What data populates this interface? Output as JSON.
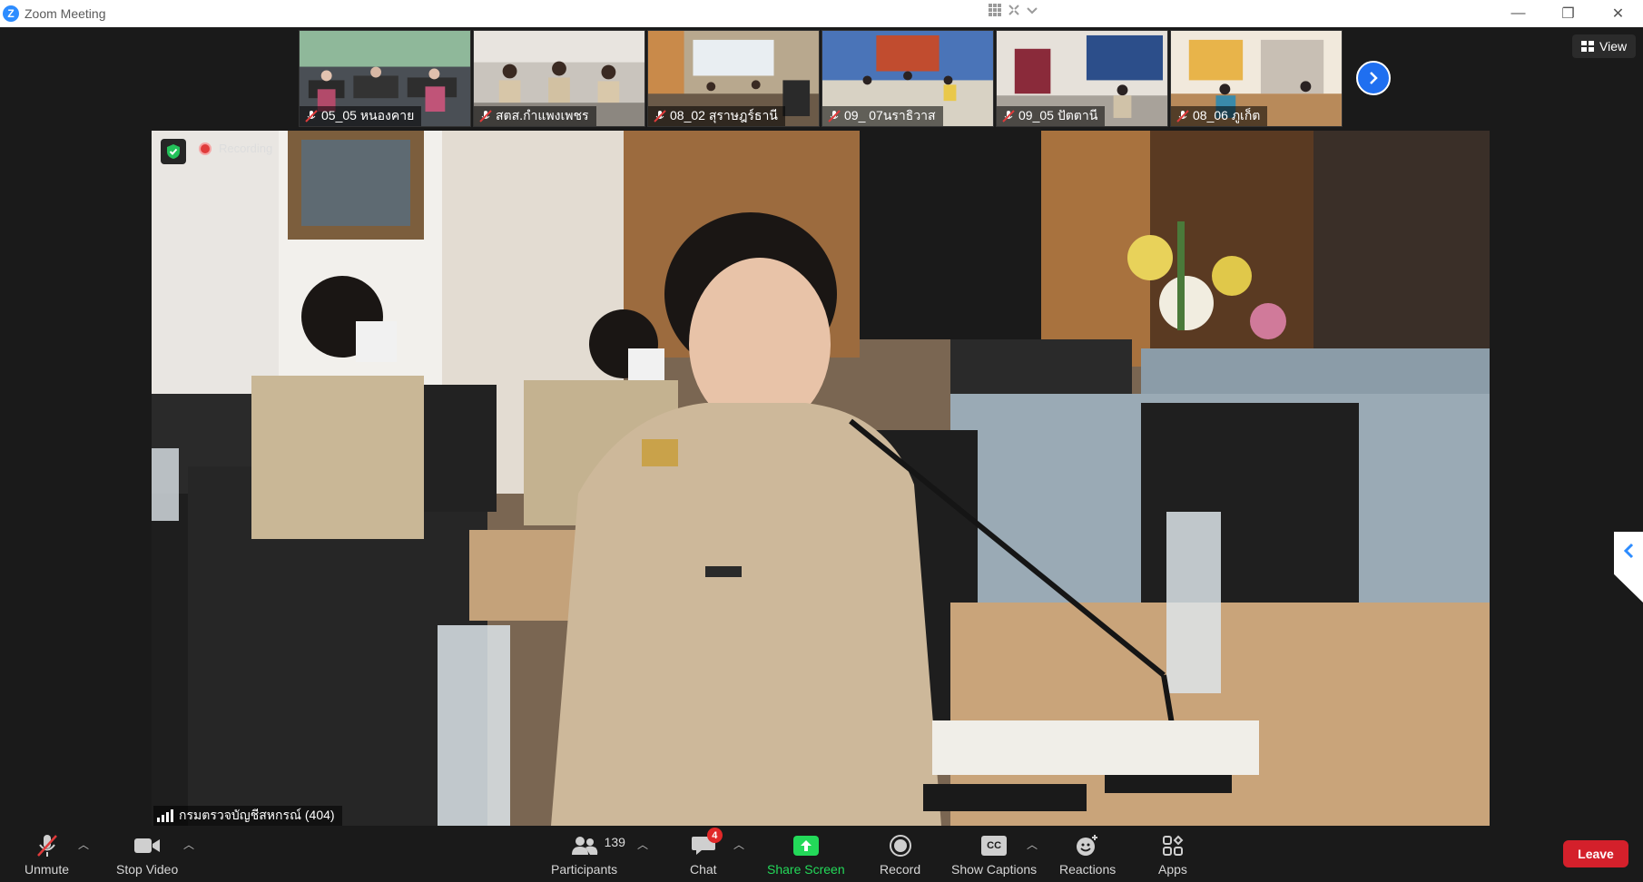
{
  "window": {
    "title": "Zoom Meeting",
    "logo_letter": "Z",
    "minimize": "—",
    "restore": "❐",
    "close": "✕"
  },
  "view_button": {
    "label": "View"
  },
  "thumbnails": [
    {
      "label": "05_05 หนองคาย"
    },
    {
      "label": "สตส.กำแพงเพชร"
    },
    {
      "label": "08_02 สุราษฎร์ธานี"
    },
    {
      "label": "09_ 07นราธิวาส"
    },
    {
      "label": "09_05 ปัตตานี"
    },
    {
      "label": "08_06 ภูเก็ต"
    }
  ],
  "speaker": {
    "name": "กรมตรวจบัญชีสหกรณ์ (404)",
    "recording_label": "Recording"
  },
  "toolbar": {
    "unmute": "Unmute",
    "stop_video": "Stop Video",
    "participants": "Participants",
    "participants_count": "139",
    "chat": "Chat",
    "chat_badge": "4",
    "share_screen": "Share Screen",
    "record": "Record",
    "show_captions": "Show Captions",
    "captions_icon_text": "CC",
    "reactions": "Reactions",
    "apps": "Apps",
    "leave": "Leave"
  },
  "colors": {
    "accent": "#2d8cff",
    "share_green": "#23d959",
    "leave_red": "#d4202b",
    "mic_off_red": "#e03b3b"
  }
}
